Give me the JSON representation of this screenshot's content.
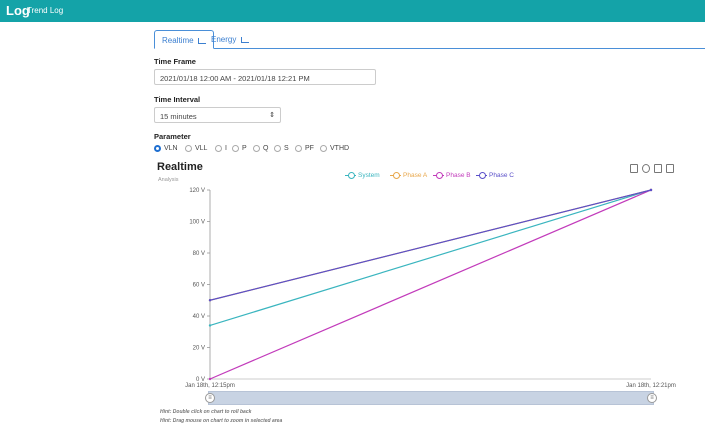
{
  "app": {
    "brand": "Log",
    "subtitle": "Trend Log"
  },
  "tabs": [
    {
      "label": "Realtime",
      "active": true
    },
    {
      "label": "Energy",
      "active": false
    }
  ],
  "form": {
    "time_frame_label": "Time Frame",
    "time_frame_value": "2021/01/18 12:00 AM - 2021/01/18 12:21 PM",
    "time_interval_label": "Time Interval",
    "time_interval_value": "15 minutes",
    "parameter_label": "Parameter",
    "parameters": [
      "VLN",
      "VLL",
      "I",
      "P",
      "Q",
      "S",
      "PF",
      "VTHD"
    ],
    "selected_parameter": "VLN"
  },
  "chart_data": {
    "type": "line",
    "title": "Realtime",
    "subtitle": "Analysis",
    "categories": [
      "Jan 18th, 12:15pm",
      "Jan 18th, 12:21pm"
    ],
    "yticks": [
      "0 V",
      "20 V",
      "40 V",
      "60 V",
      "80 V",
      "100 V",
      "120 V"
    ],
    "ylim": [
      0,
      120
    ],
    "series": [
      {
        "name": "System",
        "color": "#3ab5bf",
        "values": [
          34,
          120
        ]
      },
      {
        "name": "Phase A",
        "color": "#e8a74a",
        "values": [
          50,
          120
        ]
      },
      {
        "name": "Phase B",
        "color": "#c23bbb",
        "values": [
          0,
          120
        ]
      },
      {
        "name": "Phase C",
        "color": "#5a4fc9",
        "values": [
          50,
          120
        ]
      }
    ],
    "legend": "top-center",
    "grid": false
  },
  "hints": [
    "Hint: Double click on chart to roll back",
    "Hint: Drag mouse on chart to zoom in selected area"
  ],
  "colors": {
    "header": "#14a3a8",
    "accent": "#1f6fd0"
  }
}
